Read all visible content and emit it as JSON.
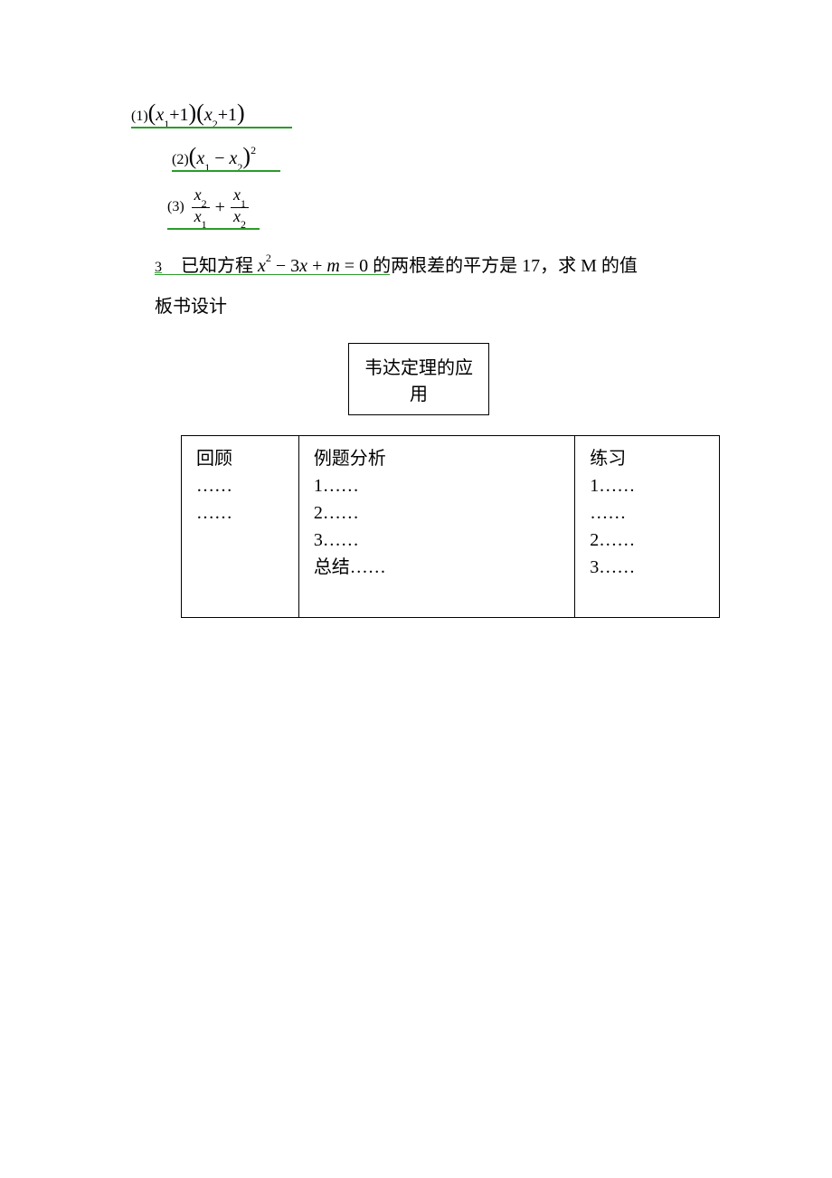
{
  "equations": {
    "eq1": {
      "label": "(1)",
      "expr_open": "(",
      "term1_var": "x",
      "term1_sub": "1",
      "plus1": "+1",
      "mid_close": ")",
      "mid_open": "(",
      "term2_var": "x",
      "term2_sub": "2",
      "plus2": "+1",
      "close": ")"
    },
    "eq2": {
      "label": "(2)",
      "open": "(",
      "t1_var": "x",
      "t1_sub": "1",
      "minus": " − ",
      "t2_var": "x",
      "t2_sub": "2",
      "close": ")",
      "sup": "2"
    },
    "eq3": {
      "label": "(3)",
      "f1_top_var": "x",
      "f1_top_sub": "2",
      "f1_bot_var": "x",
      "f1_bot_sub": "1",
      "plus": "+",
      "f2_top_var": "x",
      "f2_top_sub": "1",
      "f2_bot_var": "x",
      "f2_bot_sub": "2"
    }
  },
  "question3": {
    "num": "3",
    "pre": "已知方程",
    "eq_x": "x",
    "eq_sup": "2",
    "eq_minus": " − 3",
    "eq_x2": "x",
    "eq_plus": " + ",
    "eq_m": "m",
    "eq_eq": " = 0",
    "post": " 的两根差的平方是 17，求 M 的值"
  },
  "board_design_label": "板书设计",
  "title_box": "韦达定理的应用",
  "board": {
    "col1": {
      "header": "回顾",
      "lines": [
        "……",
        "……"
      ]
    },
    "col2": {
      "header": "例题分析",
      "lines": [
        "1……",
        "2……",
        "3……",
        "总结……"
      ]
    },
    "col3": {
      "header": "练习",
      "lines": [
        "1……",
        "……",
        "2……",
        "3……"
      ]
    }
  }
}
